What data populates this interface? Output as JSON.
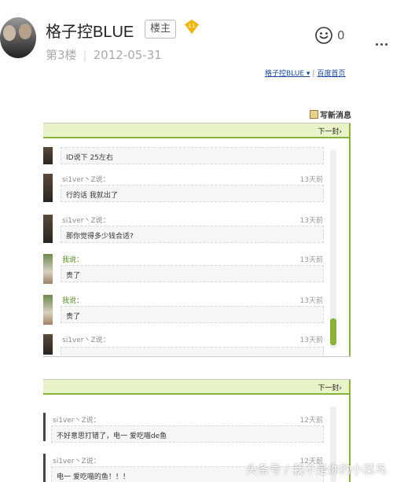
{
  "post": {
    "username": "格子控BLUE",
    "owner_badge": "楼主",
    "level": "11",
    "floor": "第3楼",
    "date": "2012-05-31",
    "like_count": "0"
  },
  "screenshot": {
    "top_links": [
      "格子控BLUE ▾",
      "百度首页"
    ],
    "compose_label": "写新消息",
    "panel1": {
      "next_label": "下一封›",
      "first_text": "ID说下  25左右",
      "messages": [
        {
          "name": "si1ver丶Z说：",
          "time": "13天前",
          "text": "行的话 我就出了"
        },
        {
          "name": "si1ver丶Z说：",
          "time": "13天前",
          "text": "那你觉得多少钱合适?"
        },
        {
          "name": "我说：",
          "time": "13天前",
          "text": "贵了"
        },
        {
          "name": "我说：",
          "time": "13天前",
          "text": "贵了"
        },
        {
          "name": "si1ver丶Z说：",
          "time": "13天前",
          "text": ""
        }
      ]
    },
    "panel2": {
      "next_label": "下一封›",
      "messages": [
        {
          "name": "si1ver丶Z说：",
          "time": "12天前",
          "text": "不好意思打错了，电一 爱吃喵de鱼"
        },
        {
          "name": "si1ver丶Z说：",
          "time": "12天前",
          "text": "电一 爱吃喵的鱼！！！"
        }
      ]
    }
  },
  "watermark": "头条号 / 我不是你的小菜鸟",
  "colors": {
    "accent_green": "#8ab23a",
    "badge_gold": "#f0b400"
  }
}
